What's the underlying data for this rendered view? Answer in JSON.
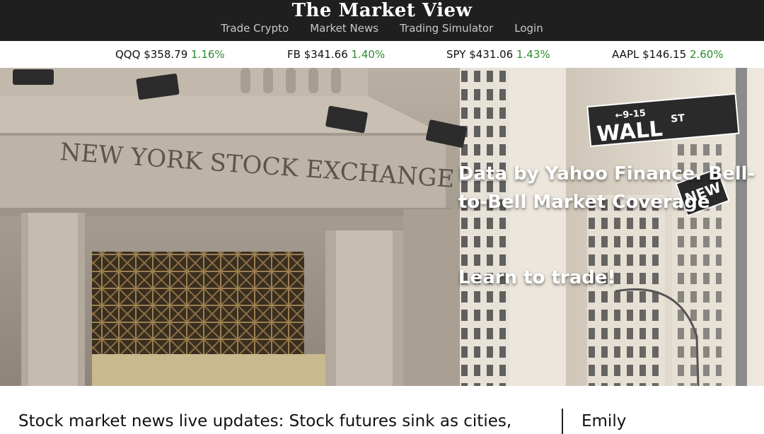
{
  "header": {
    "brand": "The Market View",
    "nav": [
      "Trade Crypto",
      "Market News",
      "Trading Simulator",
      "Login"
    ]
  },
  "ticker": [
    {
      "symbol": "QQQ",
      "price": "$358.79",
      "change": "1.16%"
    },
    {
      "symbol": "FB",
      "price": "$341.66",
      "change": "1.40%"
    },
    {
      "symbol": "SPY",
      "price": "$431.06",
      "change": "1.43%"
    },
    {
      "symbol": "AAPL",
      "price": "$146.15",
      "change": "2.60%"
    }
  ],
  "hero": {
    "facade_text": "NEW YORK STOCK EXCHANGE",
    "sign_top": "←9-15",
    "sign_main": "WALL",
    "sign_suffix": "ST",
    "sign_second": "NEW",
    "tagline": "Data by Yahoo Finance. Bell-to-Bell Market Coverage",
    "cta": "Learn to trade!"
  },
  "news": {
    "headline": "Stock market news live updates: Stock futures sink as cities,"
  },
  "sidebar": {
    "user": "Emily"
  },
  "colors": {
    "header_bg": "#1f1f1f",
    "positive_change": "#2e8b2e"
  }
}
